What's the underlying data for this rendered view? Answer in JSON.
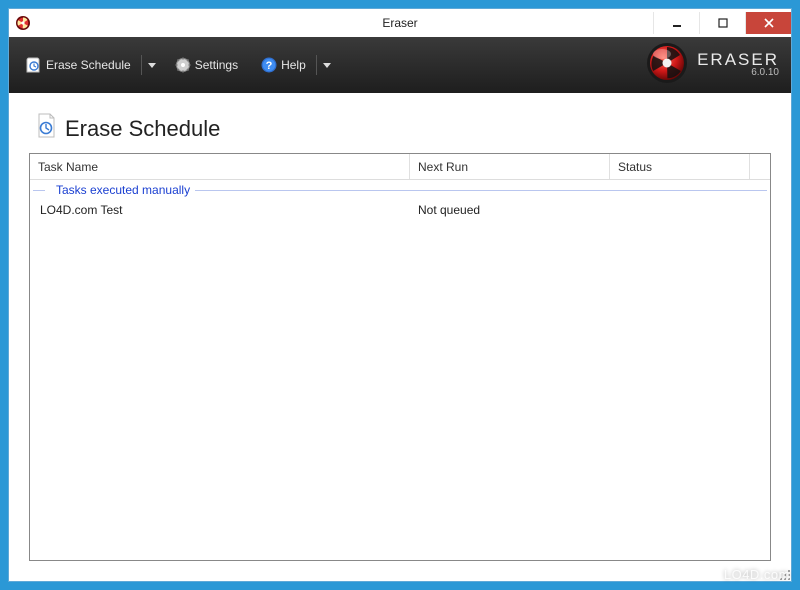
{
  "window": {
    "title": "Eraser"
  },
  "toolbar": {
    "erase_schedule": "Erase Schedule",
    "settings": "Settings",
    "help": "Help"
  },
  "brand": {
    "name": "ERASER",
    "version": "6.0.10"
  },
  "page": {
    "title": "Erase Schedule"
  },
  "columns": {
    "task_name": "Task Name",
    "next_run": "Next Run",
    "status": "Status"
  },
  "group_label": "Tasks executed manually",
  "tasks": [
    {
      "name": "LO4D.com Test",
      "next_run": "Not queued",
      "status": ""
    }
  ],
  "watermark": "LO4D.com"
}
